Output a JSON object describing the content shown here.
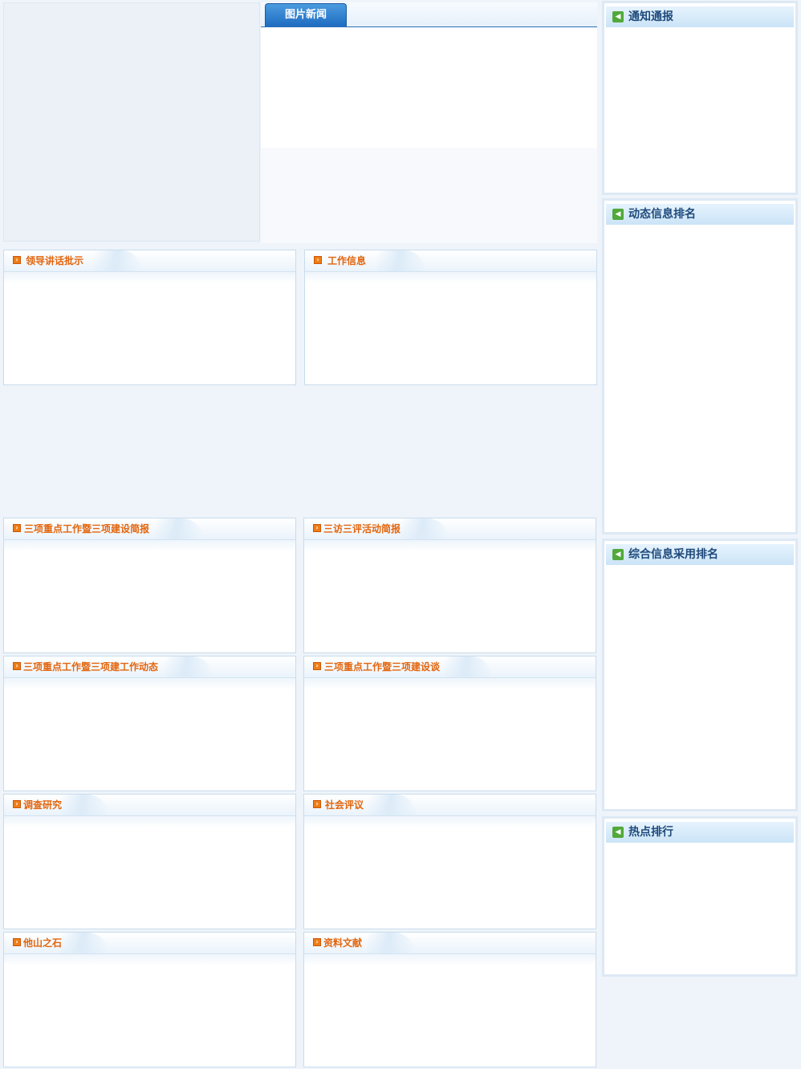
{
  "picture_news": {
    "tab_label": "图片新闻"
  },
  "panels": [
    {
      "title": "领导讲话批示"
    },
    {
      "title": "工作信息"
    },
    {
      "title": "三项重点工作暨三项建设简报"
    },
    {
      "title": "三访三评活动简报"
    },
    {
      "title": "三项重点工作暨三项建工作动态"
    },
    {
      "title": "三项重点工作暨三项建设谈"
    },
    {
      "title": "调查研究"
    },
    {
      "title": "社会评议"
    },
    {
      "title": "他山之石"
    },
    {
      "title": "资料文献"
    }
  ],
  "sidebar": [
    {
      "title": "通知通报"
    },
    {
      "title": "动态信息排名"
    },
    {
      "title": "综合信息采用排名"
    },
    {
      "title": "热点排行"
    }
  ],
  "icons": {
    "panel_icon": "orange-arrow-icon",
    "sidebar_icon": "speaker-icon"
  },
  "colors": {
    "panel_title": "#e2660f",
    "sidebar_title": "#1e4a7c",
    "tab_bg": "#1e6cc0"
  }
}
